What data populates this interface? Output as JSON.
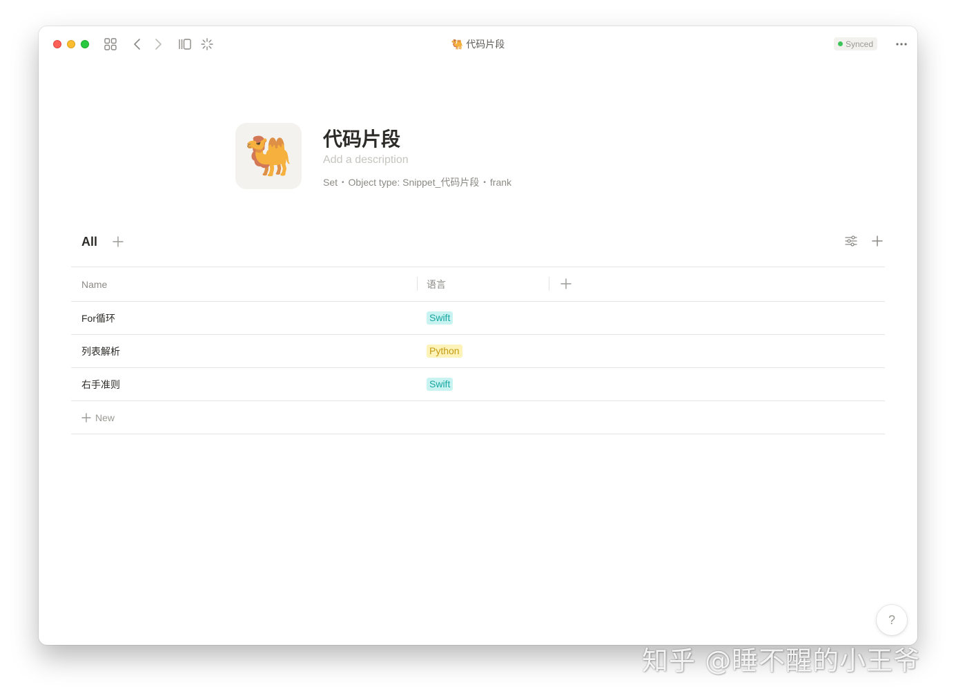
{
  "window": {
    "title": "代码片段",
    "title_icon": "🐫",
    "sync_status": "Synced",
    "sync_color": "#3cc35a"
  },
  "object": {
    "icon": "🐫",
    "title": "代码片段",
    "description_placeholder": "Add a description",
    "meta": {
      "layout": "Set",
      "object_type": "Object type: Snippet_代码片段",
      "author": "frank"
    }
  },
  "view": {
    "tab_label": "All"
  },
  "table": {
    "columns": [
      "Name",
      "语言"
    ],
    "rows": [
      {
        "name": "For循环",
        "lang": "Swift",
        "lang_color": "#17a6a0"
      },
      {
        "name": "列表解析",
        "lang": "Python",
        "lang_color": "#c49a12"
      },
      {
        "name": "右手准则",
        "lang": "Swift",
        "lang_color": "#17a6a0"
      }
    ],
    "new_label": "New"
  },
  "help": {
    "label": "?"
  },
  "watermark": "知乎 @睡不醒的小王爷"
}
